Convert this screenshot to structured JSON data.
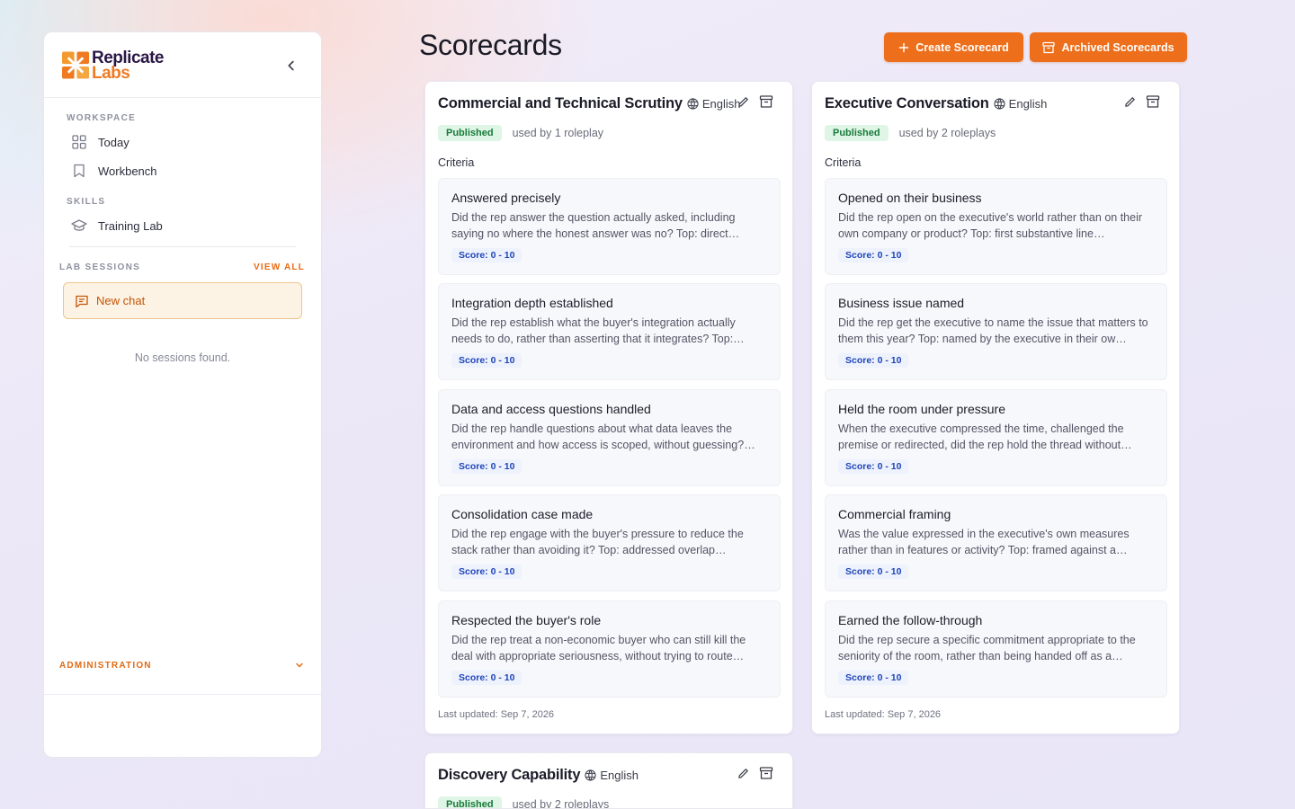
{
  "brand": {
    "line1": "Replicate",
    "line2": "Labs",
    "colors": {
      "orange": "#ef7a22",
      "purple": "#2a1745"
    }
  },
  "sidebar": {
    "workspace_label": "WORKSPACE",
    "workspace_items": [
      {
        "label": "Today",
        "icon": "grid-icon"
      },
      {
        "label": "Workbench",
        "icon": "bookmark-icon"
      }
    ],
    "skills_label": "SKILLS",
    "skills_items": [
      {
        "label": "Training Lab",
        "icon": "graduation-cap-icon"
      }
    ],
    "lab_sessions_label": "LAB SESSIONS",
    "view_all_label": "VIEW ALL",
    "new_chat_label": "New chat",
    "no_sessions_text": "No sessions found.",
    "administration_label": "ADMINISTRATION"
  },
  "header": {
    "title": "Scorecards",
    "create_label": "Create Scorecard",
    "archived_label": "Archived Scorecards",
    "accent": "#ee6f1b"
  },
  "cards": [
    {
      "title": "Commercial and Technical Scrutiny",
      "language": "English",
      "status": "Published",
      "used_by": "used by 1 roleplay",
      "criteria_label": "Criteria",
      "criteria": [
        {
          "title": "Answered precisely",
          "desc": "Did the rep answer the question actually asked, including saying no where the honest answer was no? Top: direct…",
          "score": "Score: 0 - 10"
        },
        {
          "title": "Integration depth established",
          "desc": "Did the rep establish what the buyer's integration actually needs to do, rather than asserting that it integrates? Top:…",
          "score": "Score: 0 - 10"
        },
        {
          "title": "Data and access questions handled",
          "desc": "Did the rep handle questions about what data leaves the environment and how access is scoped, without guessing?…",
          "score": "Score: 0 - 10"
        },
        {
          "title": "Consolidation case made",
          "desc": "Did the rep engage with the buyer's pressure to reduce the stack rather than avoiding it? Top: addressed overlap…",
          "score": "Score: 0 - 10"
        },
        {
          "title": "Respected the buyer's role",
          "desc": "Did the rep treat a non-economic buyer who can still kill the deal with appropriate seriousness, without trying to route…",
          "score": "Score: 0 - 10"
        }
      ],
      "last_updated": "Last updated: Sep 7, 2026"
    },
    {
      "title": "Executive Conversation",
      "language": "English",
      "status": "Published",
      "used_by": "used by 2 roleplays",
      "criteria_label": "Criteria",
      "criteria": [
        {
          "title": "Opened on their business",
          "desc": "Did the rep open on the executive's world rather than on their own company or product? Top: first substantive line…",
          "score": "Score: 0 - 10"
        },
        {
          "title": "Business issue named",
          "desc": "Did the rep get the executive to name the issue that matters to them this year? Top: named by the executive in their ow…",
          "score": "Score: 0 - 10"
        },
        {
          "title": "Held the room under pressure",
          "desc": "When the executive compressed the time, challenged the premise or redirected, did the rep hold the thread without…",
          "score": "Score: 0 - 10"
        },
        {
          "title": "Commercial framing",
          "desc": "Was the value expressed in the executive's own measures rather than in features or activity? Top: framed against a…",
          "score": "Score: 0 - 10"
        },
        {
          "title": "Earned the follow-through",
          "desc": "Did the rep secure a specific commitment appropriate to the seniority of the room, rather than being handed off as a…",
          "score": "Score: 0 - 10"
        }
      ],
      "last_updated": "Last updated: Sep 7, 2026"
    },
    {
      "title": "Discovery Capability",
      "language": "English",
      "status": "Published",
      "used_by": "used by 2 roleplays"
    }
  ]
}
